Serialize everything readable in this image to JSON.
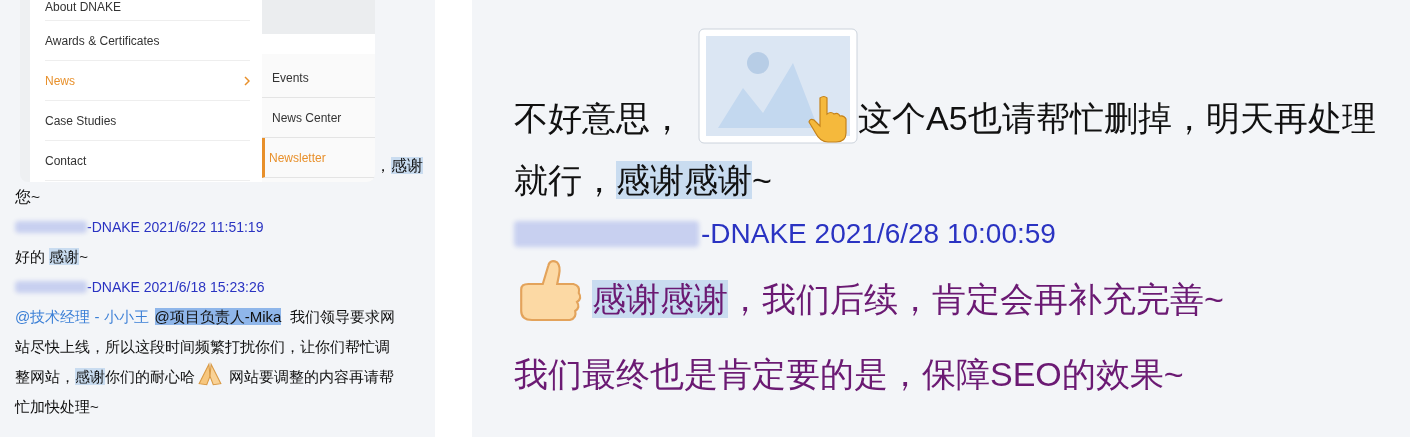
{
  "left_chat": {
    "shared_screenshot": {
      "menu": [
        {
          "label": "About DNAKE",
          "selected": false,
          "has_submenu": false
        },
        {
          "label": "Awards & Certificates",
          "selected": false,
          "has_submenu": false
        },
        {
          "label": "News",
          "selected": true,
          "has_submenu": true
        },
        {
          "label": "Case Studies",
          "selected": false,
          "has_submenu": false
        },
        {
          "label": "Contact",
          "selected": false,
          "has_submenu": false
        }
      ],
      "submenu": [
        {
          "label": "Events",
          "selected": false
        },
        {
          "label": "News Center",
          "selected": false
        },
        {
          "label": "Newsletter",
          "selected": true
        }
      ]
    },
    "first_message_tail": [
      [
        {
          "kind": "plain",
          "text": "，"
        },
        {
          "kind": "highlight",
          "text": "感谢"
        }
      ],
      [
        {
          "kind": "plain",
          "text": "您~"
        }
      ]
    ],
    "messages": [
      {
        "header": "-DNAKE 2021/6/22 11:51:19",
        "body": [
          {
            "kind": "plain",
            "text": "好的 "
          },
          {
            "kind": "highlight",
            "text": "感谢"
          },
          {
            "kind": "plain",
            "text": "~"
          }
        ]
      },
      {
        "header": "-DNAKE 2021/6/18 15:23:26",
        "body": [
          {
            "kind": "mention",
            "text": "@技术经理 - 小小王"
          },
          {
            "kind": "mention_highlight",
            "text": "@项目负责人-Mika"
          },
          {
            "kind": "plain",
            "text": " 我们领导要求网站尽快上线，所以这段时间频繁打扰你们，让你们帮忙调整网站，"
          },
          {
            "kind": "highlight",
            "text": "感谢"
          },
          {
            "kind": "plain",
            "text": "你们的耐心哈"
          },
          {
            "kind": "emoji_hands"
          },
          {
            "kind": "plain",
            "text": " 网站要调整的内容再请帮忙加快处理~"
          }
        ]
      }
    ]
  },
  "right_chat": {
    "first_message": {
      "color": "#111111",
      "body": [
        {
          "kind": "plain",
          "text": "不好意思，"
        },
        {
          "kind": "image"
        },
        {
          "kind": "plain",
          "text": "这个A5也请帮忙删掉，明天再处理就行，"
        },
        {
          "kind": "highlight",
          "text": "感谢感谢"
        },
        {
          "kind": "plain",
          "text": "~"
        }
      ]
    },
    "messages": [
      {
        "header": "-DNAKE 2021/6/28 10:00:59",
        "color": "#6b1a73",
        "body": [
          {
            "kind": "emoji_thumbs"
          },
          {
            "kind": "highlight",
            "text": "感谢感谢"
          },
          {
            "kind": "plain",
            "text": "，我们后续，肯定会再补充完善~"
          },
          {
            "kind": "break"
          },
          {
            "kind": "plain",
            "text": "我们最终也是肯定要的是，保障SEO的效果~"
          }
        ]
      }
    ]
  }
}
